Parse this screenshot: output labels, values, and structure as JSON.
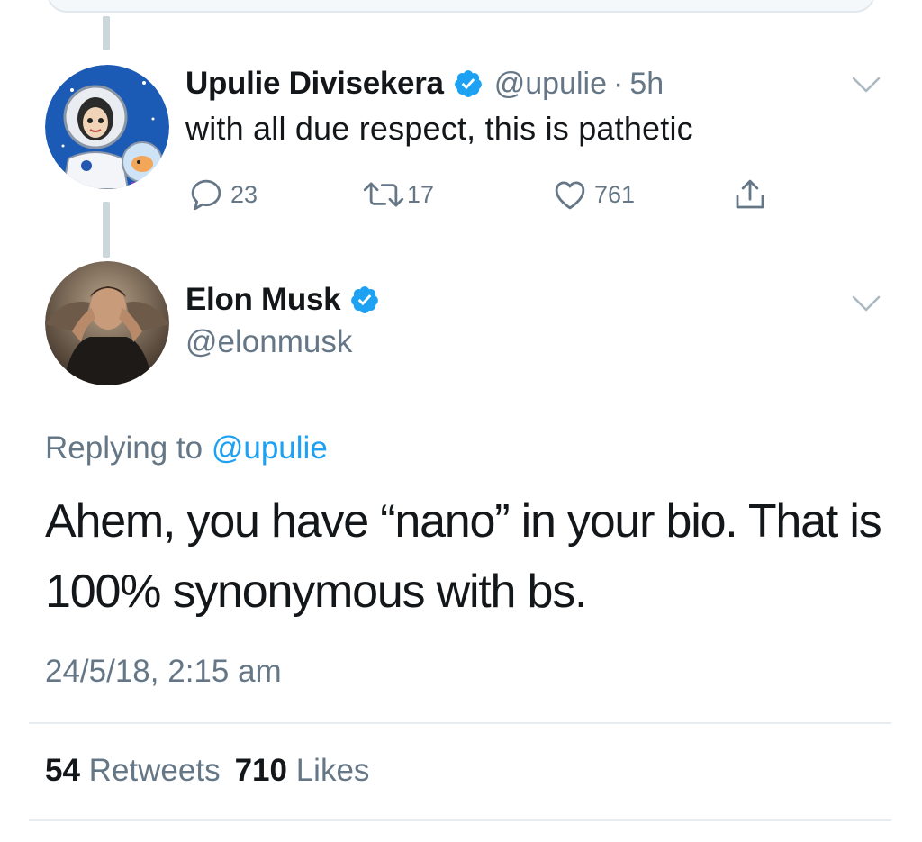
{
  "parent_tweet": {
    "display_name": "Upulie Divisekera",
    "handle": "@upulie",
    "separator": "·",
    "time": "5h",
    "text": "with all due respect, this is pathetic",
    "replies": "23",
    "retweets": "17",
    "likes": "761",
    "verified": true
  },
  "main_tweet": {
    "display_name": "Elon Musk",
    "handle": "@elonmusk",
    "verified": true,
    "replying_prefix": "Replying to",
    "replying_mention": "@upulie",
    "text": "Ahem, you have “nano” in your bio. That is 100% synonymous with bs.",
    "timestamp": "24/5/18, 2:15 am",
    "retweet_count": "54",
    "retweet_label": "Retweets",
    "like_count": "710",
    "like_label": "Likes"
  },
  "icons": {
    "verified": "verified-badge-icon",
    "caret": "chevron-down-icon",
    "reply": "reply-icon",
    "retweet": "retweet-icon",
    "like": "heart-icon",
    "share": "share-icon"
  },
  "colors": {
    "accent": "#1da1f2",
    "secondary_text": "#657786",
    "primary_text": "#14171a",
    "divider": "#e6ecf0"
  }
}
